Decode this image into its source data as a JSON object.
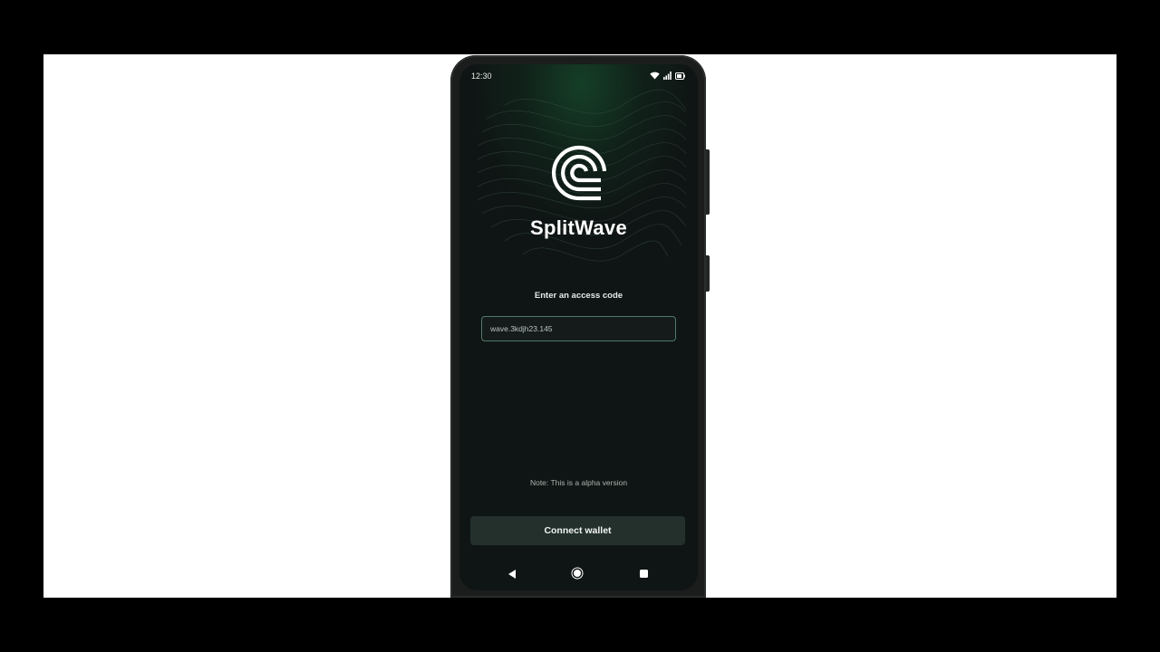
{
  "status_bar": {
    "time": "12:30",
    "icons": [
      "wifi-icon",
      "signal-icon",
      "battery-icon"
    ]
  },
  "app": {
    "name": "SplitWave",
    "logo_icon": "splitwave-logo-icon"
  },
  "access": {
    "prompt": "Enter an access code",
    "input_value": "wave.3kdjh23.145"
  },
  "note": "Note: This is a alpha version",
  "actions": {
    "connect_label": "Connect wallet"
  },
  "nav_bar": {
    "icons": [
      "back-icon",
      "home-icon",
      "recents-icon"
    ]
  },
  "colors": {
    "screen_background": "#0f1514",
    "accent_glow": "#16462a",
    "button_background": "#23302c",
    "input_border": "#4f7a68"
  }
}
